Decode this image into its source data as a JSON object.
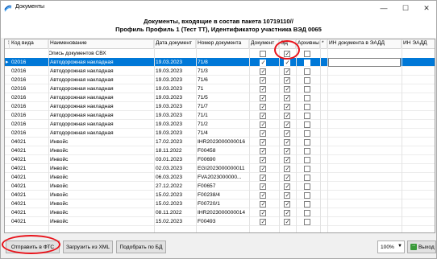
{
  "window": {
    "title": "Документы",
    "min": "—",
    "max": "☐",
    "close": "✕"
  },
  "header": {
    "line1": "Документы, входящие в состав пакета 10719110//",
    "line2": "Профиль Профиль 1 (Тест ТТ), Идентификатор участника ВЭД 0065"
  },
  "grid": {
    "columns": {
      "code": "Код вида",
      "name": "Наименование",
      "date": "Дата документ",
      "number": "Номер документа",
      "doc": "Документ",
      "ed": "ЭД",
      "archive": "Архивны",
      "star": "*",
      "eadd_in": "ИН документа в ЭАДД",
      "eadd_in2": "ИН ЭАДД"
    },
    "subheader": "Опись документов СВХ",
    "rows": [
      {
        "code": "02016",
        "name": "Автодорожная накладная",
        "date": "19.03.2023",
        "number": "71/8",
        "doc": true,
        "ed": true,
        "archive": false,
        "selected": true
      },
      {
        "code": "02016",
        "name": "Автодорожная накладная",
        "date": "19.03.2023",
        "number": "71/3",
        "doc": true,
        "ed": true,
        "archive": false,
        "selected": false
      },
      {
        "code": "02016",
        "name": "Автодорожная накладная",
        "date": "19.03.2023",
        "number": "71/6",
        "doc": true,
        "ed": true,
        "archive": false,
        "selected": false
      },
      {
        "code": "02016",
        "name": "Автодорожная накладная",
        "date": "19.03.2023",
        "number": "71",
        "doc": true,
        "ed": true,
        "archive": false,
        "selected": false
      },
      {
        "code": "02016",
        "name": "Автодорожная накладная",
        "date": "19.03.2023",
        "number": "71/5",
        "doc": true,
        "ed": true,
        "archive": false,
        "selected": false
      },
      {
        "code": "02016",
        "name": "Автодорожная накладная",
        "date": "19.03.2023",
        "number": "71/7",
        "doc": true,
        "ed": true,
        "archive": false,
        "selected": false
      },
      {
        "code": "02016",
        "name": "Автодорожная накладная",
        "date": "19.03.2023",
        "number": "71/1",
        "doc": true,
        "ed": true,
        "archive": false,
        "selected": false
      },
      {
        "code": "02016",
        "name": "Автодорожная накладная",
        "date": "19.03.2023",
        "number": "71/2",
        "doc": true,
        "ed": true,
        "archive": false,
        "selected": false
      },
      {
        "code": "02016",
        "name": "Автодорожная накладная",
        "date": "19.03.2023",
        "number": "71/4",
        "doc": true,
        "ed": true,
        "archive": false,
        "selected": false
      },
      {
        "code": "04021",
        "name": "Инвойс",
        "date": "17.02.2023",
        "number": "IHR2023000000016",
        "doc": true,
        "ed": true,
        "archive": false,
        "selected": false
      },
      {
        "code": "04021",
        "name": "Инвойс",
        "date": "18.11.2022",
        "number": "F00458",
        "doc": true,
        "ed": true,
        "archive": false,
        "selected": false
      },
      {
        "code": "04021",
        "name": "Инвойс",
        "date": "03.01.2023",
        "number": "F00690",
        "doc": true,
        "ed": true,
        "archive": false,
        "selected": false
      },
      {
        "code": "04021",
        "name": "Инвойс",
        "date": "02.03.2023",
        "number": "EGI2023000000011",
        "doc": true,
        "ed": true,
        "archive": false,
        "selected": false
      },
      {
        "code": "04021",
        "name": "Инвойс",
        "date": "06.03.2023",
        "number": "FVA2023000000...",
        "doc": true,
        "ed": true,
        "archive": false,
        "selected": false
      },
      {
        "code": "04021",
        "name": "Инвойс",
        "date": "27.12.2022",
        "number": "F00657",
        "doc": true,
        "ed": true,
        "archive": false,
        "selected": false
      },
      {
        "code": "04021",
        "name": "Инвойс",
        "date": "15.02.2023",
        "number": "F00238/4",
        "doc": true,
        "ed": true,
        "archive": false,
        "selected": false
      },
      {
        "code": "04021",
        "name": "Инвойс",
        "date": "15.02.2023",
        "number": "F00720/1",
        "doc": true,
        "ed": true,
        "archive": false,
        "selected": false
      },
      {
        "code": "04021",
        "name": "Инвойс",
        "date": "08.11.2022",
        "number": "IHR2023000000014",
        "doc": true,
        "ed": true,
        "archive": false,
        "selected": false
      },
      {
        "code": "04021",
        "name": "Инвойс",
        "date": "15.02.2023",
        "number": "F00493",
        "doc": true,
        "ed": true,
        "archive": false,
        "selected": false
      }
    ]
  },
  "toolbar": {
    "send_label": "Отправить в ФТС",
    "load_xml_label": "Загрузить из XML",
    "match_db_label": "Подобрать по БД",
    "zoom_value": "100%",
    "exit_label": "Выход"
  },
  "colors": {
    "selection": "#0078d7",
    "annotation": "#e8141c",
    "exit_icon": "#3a9a3a"
  }
}
